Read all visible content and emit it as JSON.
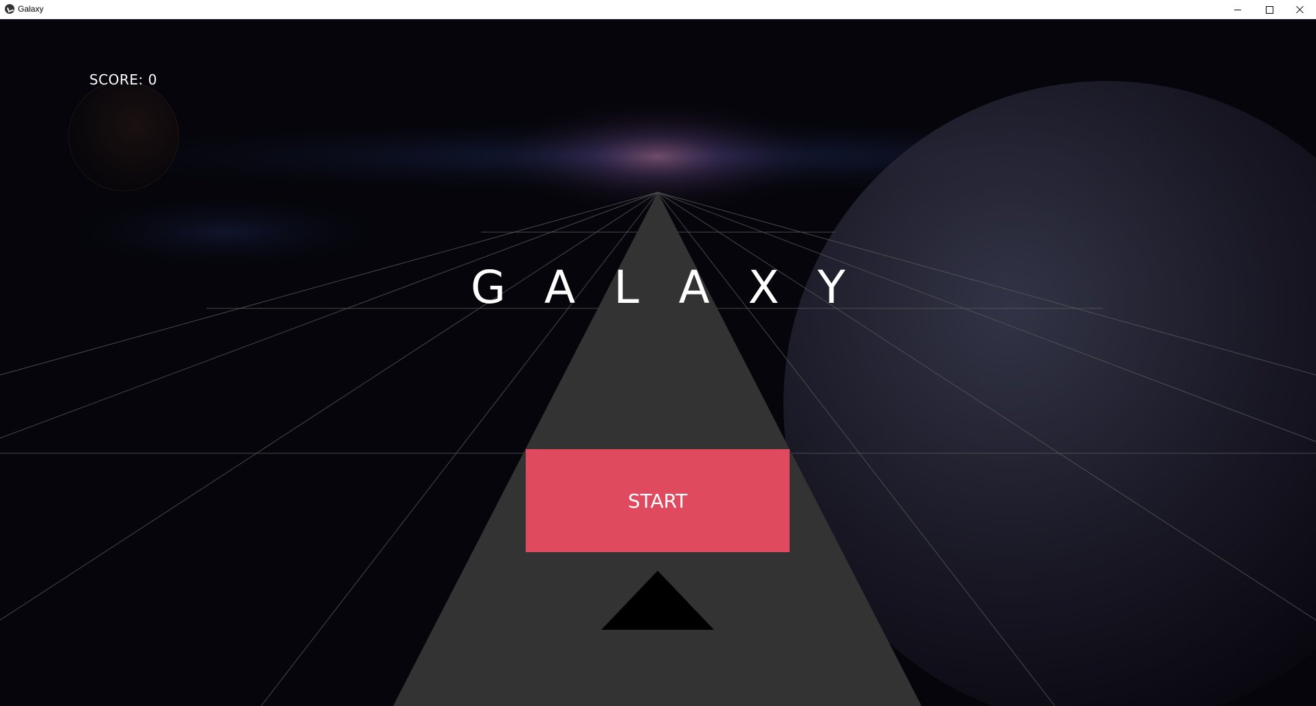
{
  "window": {
    "title": "Galaxy",
    "app_icon": "kivy-icon",
    "controls": [
      "minimize-icon",
      "maximize-icon",
      "close-icon"
    ]
  },
  "game": {
    "score_text": "SCORE: 0",
    "title_text": "GALAXY",
    "start_label": "START"
  },
  "colors": {
    "background": "#04040a",
    "track": "#333333",
    "grid_lines": "#555555",
    "start_button": "#e04a5f",
    "ship": "#000000",
    "text": "#ffffff"
  }
}
